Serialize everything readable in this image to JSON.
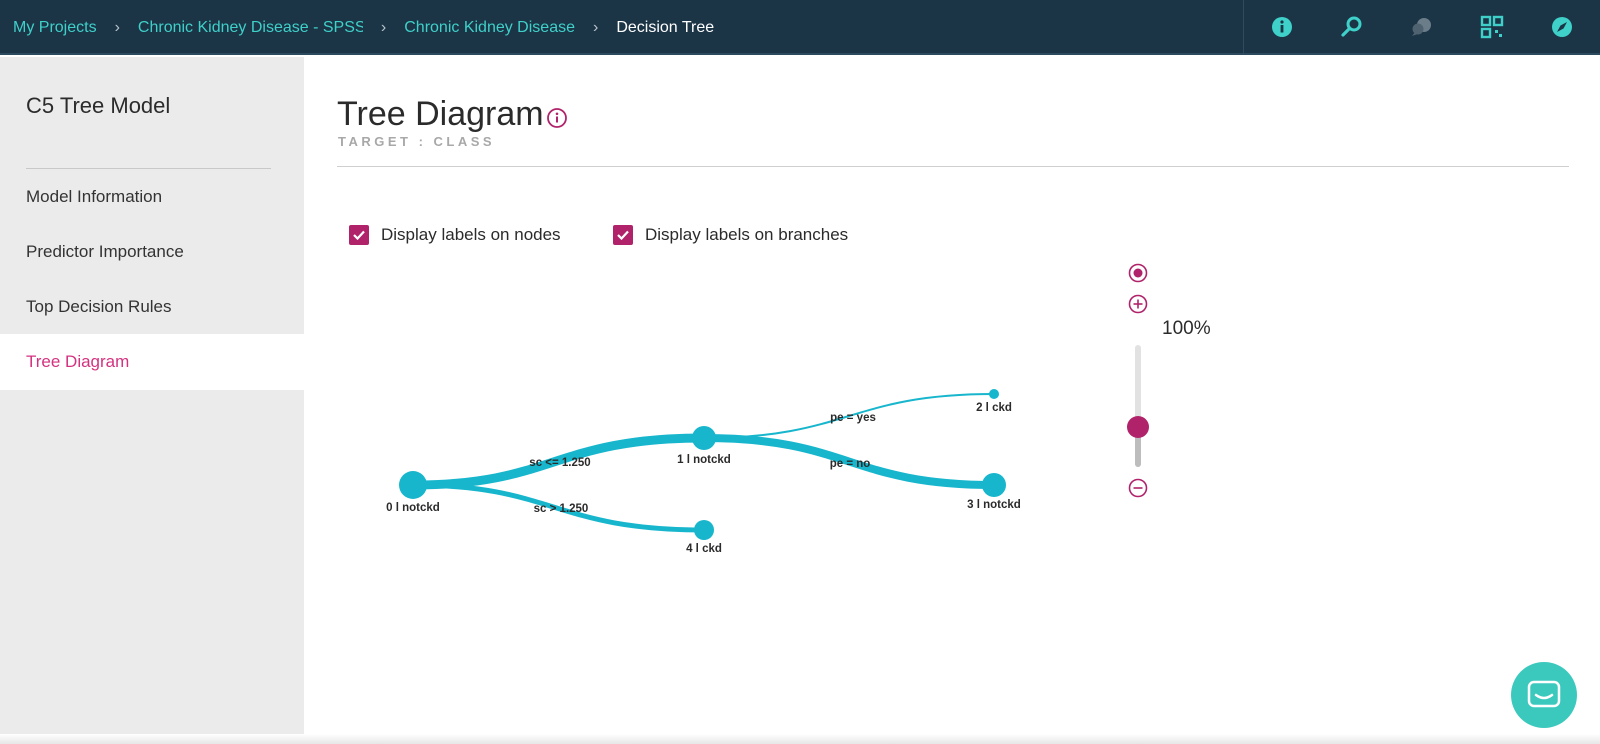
{
  "breadcrumbs": [
    {
      "label": "My Projects"
    },
    {
      "label": "Chronic Kidney Disease - SPSS Modeler Flow"
    },
    {
      "label": "Chronic Kidney Disease"
    },
    {
      "label": "Decision Tree"
    }
  ],
  "toolbar_icons": [
    "info-icon",
    "search-icon",
    "comment-icon",
    "layout-icon",
    "compass-icon"
  ],
  "sidebar": {
    "title": "C5 Tree Model",
    "items": [
      {
        "label": "Model Information"
      },
      {
        "label": "Predictor Importance"
      },
      {
        "label": "Top Decision Rules"
      },
      {
        "label": "Tree Diagram",
        "active": true
      }
    ]
  },
  "main": {
    "title": "Tree Diagram",
    "subtitle": "TARGET : CLASS",
    "options": [
      {
        "label": "Display labels on nodes",
        "checked": true
      },
      {
        "label": "Display labels on branches",
        "checked": true
      }
    ],
    "zoom": {
      "label": "100%",
      "value": 100
    }
  },
  "tree": {
    "nodes": [
      {
        "id": 0,
        "label": "0 l notckd"
      },
      {
        "id": 1,
        "label": "1 l notckd"
      },
      {
        "id": 2,
        "label": "2 l ckd"
      },
      {
        "id": 3,
        "label": "3 l notckd"
      },
      {
        "id": 4,
        "label": "4 l ckd"
      }
    ],
    "branches": [
      {
        "from": 0,
        "to": 1,
        "label": "sc <= 1.250"
      },
      {
        "from": 0,
        "to": 4,
        "label": "sc > 1.250"
      },
      {
        "from": 1,
        "to": 2,
        "label": "pe = yes"
      },
      {
        "from": 1,
        "to": 3,
        "label": "pe = no"
      }
    ]
  },
  "colors": {
    "topbar": "#1b3446",
    "link": "#3fd0c9",
    "accent": "#b0236a",
    "active_nav": "#d4327f",
    "tree": "#17b6cd",
    "chat": "#3cc9bd"
  }
}
